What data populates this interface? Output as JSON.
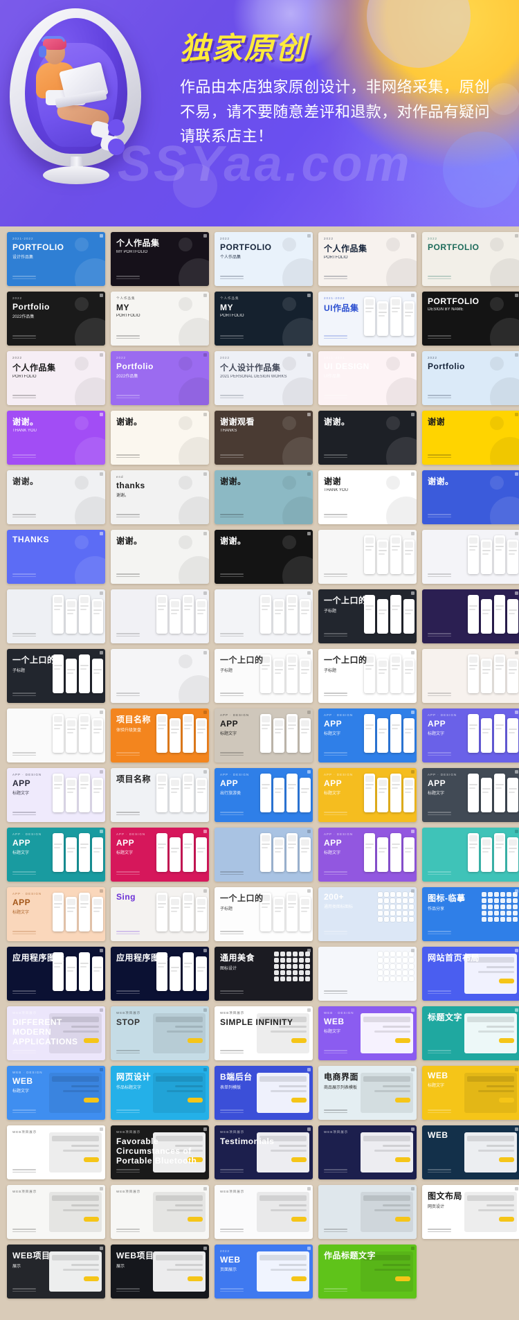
{
  "banner": {
    "title": "独家原创",
    "body": "作品由本店独家原创设计，非网络采集，原创不易，请不要随意差评和退款，对作品有疑问请联系店主！",
    "watermark": "SSYaa.com",
    "colors": {
      "bg_purple": "#6d4fe8",
      "title_yellow": "#ffeb3b",
      "sun_yellow": "#ffc93a",
      "page_bg": "#d9cbb8"
    },
    "illustration": "person-on-egg-chair-with-laptop"
  },
  "grid": {
    "columns": 5,
    "thumbs": [
      {
        "id": 1,
        "title": "PORTFOLIO",
        "sub": "设计作品集",
        "kicker": "2021-2022",
        "bg": "#2f7fd4",
        "fg": "#ffffff",
        "style": "blue-chart"
      },
      {
        "id": 2,
        "title": "个人作品集",
        "sub": "MY PORTFOLIO",
        "kicker": "",
        "bg": "#16111a",
        "fg": "#ffffff",
        "style": "dark-bokeh"
      },
      {
        "id": 3,
        "title": "PORTFOLIO",
        "sub": "个人作品集",
        "kicker": "2022",
        "bg": "#e9f2fb",
        "fg": "#16243a",
        "style": "light-rocket"
      },
      {
        "id": 4,
        "title": "个人作品集",
        "sub": "PORTFOLIO",
        "kicker": "2022",
        "bg": "#f7f2ee",
        "fg": "#16243a",
        "style": "pink-rocket"
      },
      {
        "id": 5,
        "title": "PORTFOLIO",
        "sub": "",
        "kicker": "2022",
        "bg": "#f2efe8",
        "fg": "#1d6b5a",
        "style": "panda"
      },
      {
        "id": 6,
        "title": "Portfolio",
        "sub": "2022作品集",
        "kicker": "2022",
        "bg": "#1a1a1a",
        "fg": "#ffffff",
        "style": "moon"
      },
      {
        "id": 7,
        "title": "MY",
        "sub": "PORTFOLIO",
        "kicker": "个人作品集",
        "bg": "#f6f5f2",
        "fg": "#1a1a1a",
        "style": "guitar"
      },
      {
        "id": 8,
        "title": "MY",
        "sub": "PORTFOLIO",
        "kicker": "个人作品集",
        "bg": "#15212e",
        "fg": "#ffffff",
        "style": "dark-mountain"
      },
      {
        "id": 9,
        "title": "UI作品集",
        "sub": "",
        "kicker": "2021-2022",
        "bg": "#f2f5fb",
        "fg": "#2b4fd0",
        "style": "ui-person"
      },
      {
        "id": 10,
        "title": "PORTFOLIO",
        "sub": "DESIGN BY NAME",
        "kicker": "",
        "bg": "#141414",
        "fg": "#ffffff",
        "style": "black-portfolio"
      },
      {
        "id": 11,
        "title": "个人作品集",
        "sub": "PORTFOLIO",
        "kicker": "2022",
        "bg": "#f6eef5",
        "fg": "#1a1a1a",
        "style": "pastel-pen"
      },
      {
        "id": 12,
        "title": "Portfolio",
        "sub": "2022作品集",
        "kicker": "2022",
        "bg": "#9b6bf0",
        "fg": "#ffffff",
        "style": "purple-portfolio"
      },
      {
        "id": 13,
        "title": "个人设计作品集",
        "sub": "2021 PERSONAL DESIGN WORKS",
        "kicker": "2022",
        "bg": "#eef0f6",
        "fg": "#444a5a",
        "style": "blobs"
      },
      {
        "id": 14,
        "title": "UI DESIGN",
        "sub": "UI作品集",
        "kicker": "2021-2022",
        "bg": "#fdf3f5",
        "fg": "#ffffff",
        "style": "pink-ui"
      },
      {
        "id": 15,
        "title": "Portfolio",
        "sub": "",
        "kicker": "2022",
        "bg": "#dbeaf8",
        "fg": "#16243a",
        "style": "soft-blue"
      },
      {
        "id": 16,
        "title": "谢谢。",
        "sub": "THANK YOU",
        "kicker": "",
        "bg": "#a24df5",
        "fg": "#ffffff",
        "style": "purple-thanks"
      },
      {
        "id": 17,
        "title": "谢谢。",
        "sub": "",
        "kicker": "",
        "bg": "#fbf7ef",
        "fg": "#1a1a1a",
        "style": "bauhaus"
      },
      {
        "id": 18,
        "title": "谢谢观看",
        "sub": "THANKS",
        "kicker": "",
        "bg": "#4a3b33",
        "fg": "#ffffff",
        "style": "brown-thanks"
      },
      {
        "id": 19,
        "title": "谢谢。",
        "sub": "",
        "kicker": "",
        "bg": "#1d2026",
        "fg": "#ffffff",
        "style": "photo-dark"
      },
      {
        "id": 20,
        "title": "谢谢",
        "sub": "",
        "kicker": "",
        "bg": "#ffd400",
        "fg": "#1a1a1a",
        "style": "yellow-thanks"
      },
      {
        "id": 21,
        "title": "谢谢。",
        "sub": "",
        "kicker": "",
        "bg": "#f0f1f3",
        "fg": "#333333",
        "style": "light-thanks"
      },
      {
        "id": 22,
        "title": "thanks",
        "sub": "谢谢。",
        "kicker": "end",
        "bg": "#f2f2f2",
        "fg": "#1a1a1a",
        "style": "pencil"
      },
      {
        "id": 23,
        "title": "谢谢。",
        "sub": "",
        "kicker": "",
        "bg": "#8cb9c4",
        "fg": "#1a1a1a",
        "style": "hand-rose"
      },
      {
        "id": 24,
        "title": "谢谢",
        "sub": "THANK YOU",
        "kicker": "",
        "bg": "#ffffff",
        "fg": "#1a1a1a",
        "style": "white-thanks"
      },
      {
        "id": 25,
        "title": "谢谢。",
        "sub": "",
        "kicker": "",
        "bg": "#3b5bdb",
        "fg": "#ffffff",
        "style": "blue-thumbsup"
      },
      {
        "id": 26,
        "title": "THANKS",
        "sub": "",
        "kicker": "",
        "bg": "#5c6cf5",
        "fg": "#ffffff",
        "style": "blue-thanks-big"
      },
      {
        "id": 27,
        "title": "谢谢。",
        "sub": "",
        "kicker": "",
        "bg": "#f4f4f2",
        "fg": "#1a1a1a",
        "style": "plant"
      },
      {
        "id": 28,
        "title": "谢谢。",
        "sub": "",
        "kicker": "",
        "bg": "#141414",
        "fg": "#ffffff",
        "style": "moon-dark"
      },
      {
        "id": 29,
        "title": "",
        "sub": "",
        "kicker": "",
        "bg": "#f7f7f7",
        "fg": "#555555",
        "style": "phone-mock"
      },
      {
        "id": 30,
        "title": "",
        "sub": "",
        "kicker": "",
        "bg": "#f4f4f8",
        "fg": "#555555",
        "style": "phone-mock2"
      },
      {
        "id": 31,
        "title": "",
        "sub": "",
        "kicker": "",
        "bg": "#eef0f4",
        "fg": "#555555",
        "style": "ui-screens"
      },
      {
        "id": 32,
        "title": "",
        "sub": "",
        "kicker": "",
        "bg": "#f1f1f5",
        "fg": "#555555",
        "style": "ui-screens2"
      },
      {
        "id": 33,
        "title": "",
        "sub": "",
        "kicker": "",
        "bg": "#f3f4f7",
        "fg": "#555555",
        "style": "ui-screens3"
      },
      {
        "id": 34,
        "title": "一个上口的",
        "sub": "子标题",
        "kicker": "",
        "bg": "#22262e",
        "fg": "#ffffff",
        "style": "dark-app"
      },
      {
        "id": 35,
        "title": "",
        "sub": "",
        "kicker": "",
        "bg": "#2b1f52",
        "fg": "#ffffff",
        "style": "purple-app"
      },
      {
        "id": 36,
        "title": "一个上口的",
        "sub": "子标题",
        "kicker": "",
        "bg": "#22262e",
        "fg": "#ffffff",
        "style": "dark-app2"
      },
      {
        "id": 37,
        "title": "",
        "sub": "",
        "kicker": "",
        "bg": "#f5f5f7",
        "fg": "#555555",
        "style": "wire-grid"
      },
      {
        "id": 38,
        "title": "一个上口的",
        "sub": "子标题",
        "kicker": "",
        "bg": "#fbfbfb",
        "fg": "#333333",
        "style": "white-app"
      },
      {
        "id": 39,
        "title": "一个上口的",
        "sub": "子标题",
        "kicker": "",
        "bg": "#ffffff",
        "fg": "#222222",
        "style": "white-app2"
      },
      {
        "id": 40,
        "title": "",
        "sub": "",
        "kicker": "",
        "bg": "#f7f2ee",
        "fg": "#555555",
        "style": "beige-app"
      },
      {
        "id": 41,
        "title": "",
        "sub": "",
        "kicker": "",
        "bg": "#fafafa",
        "fg": "#555555",
        "style": "light-app"
      },
      {
        "id": 42,
        "title": "项目名称",
        "sub": "体验升级复盘",
        "kicker": "",
        "bg": "#f3851e",
        "fg": "#ffffff",
        "style": "orange-app"
      },
      {
        "id": 43,
        "title": "APP",
        "sub": "标题文字",
        "kicker": "APP · DESIGN",
        "bg": "#cfc7bb",
        "fg": "#1a1a1a",
        "style": "khaki-app"
      },
      {
        "id": 44,
        "title": "APP",
        "sub": "标题文字",
        "kicker": "APP · DESIGN",
        "bg": "#2f7fe8",
        "fg": "#ffffff",
        "style": "blue-app"
      },
      {
        "id": 45,
        "title": "APP",
        "sub": "标题文字",
        "kicker": "APP · DESIGN",
        "bg": "#6a61e8",
        "fg": "#ffffff",
        "style": "indigo-app"
      },
      {
        "id": 46,
        "title": "APP",
        "sub": "标题文字",
        "kicker": "APP · DESIGN",
        "bg": "#efeafc",
        "fg": "#2a2a3a",
        "style": "lavender-app"
      },
      {
        "id": 47,
        "title": "项目名称",
        "sub": "",
        "kicker": "",
        "bg": "#f0f2f5",
        "fg": "#222222",
        "style": "hand-phone"
      },
      {
        "id": 48,
        "title": "APP",
        "sub": "出行旅游类",
        "kicker": "APP · DESIGN",
        "bg": "#2f7fe8",
        "fg": "#ffffff",
        "style": "travel-app"
      },
      {
        "id": 49,
        "title": "APP",
        "sub": "标题文字",
        "kicker": "APP · DESIGN",
        "bg": "#f5bd1f",
        "fg": "#ffffff",
        "style": "yellow-app"
      },
      {
        "id": 50,
        "title": "APP",
        "sub": "标题文字",
        "kicker": "APP · DESIGN",
        "bg": "#414a55",
        "fg": "#ffffff",
        "style": "slate-app"
      },
      {
        "id": 51,
        "title": "APP",
        "sub": "标题文字",
        "kicker": "APP · DESIGN",
        "bg": "#199ba0",
        "fg": "#ffffff",
        "style": "teal-app"
      },
      {
        "id": 52,
        "title": "APP",
        "sub": "标题文字",
        "kicker": "APP · DESIGN",
        "bg": "#d6175b",
        "fg": "#ffffff",
        "style": "crimson-app"
      },
      {
        "id": 53,
        "title": "",
        "sub": "",
        "kicker": "",
        "bg": "#a9c3e3",
        "fg": "#333333",
        "style": "screens-blue"
      },
      {
        "id": 54,
        "title": "APP",
        "sub": "标题文字",
        "kicker": "APP · DESIGN",
        "bg": "#9257e0",
        "fg": "#ffffff",
        "style": "violet-app"
      },
      {
        "id": 55,
        "title": "",
        "sub": "",
        "kicker": "",
        "bg": "#3fc3b8",
        "fg": "#ffffff",
        "style": "mint-app"
      },
      {
        "id": 56,
        "title": "APP",
        "sub": "标题文字",
        "kicker": "APP · DESIGN",
        "bg": "#fad7bb",
        "fg": "#a3571a",
        "style": "peach-app"
      },
      {
        "id": 57,
        "title": "Sing",
        "sub": "",
        "kicker": "",
        "bg": "#f4f2f0",
        "fg": "#6a2fd6",
        "style": "sing-app"
      },
      {
        "id": 58,
        "title": "一个上口的",
        "sub": "子标题",
        "kicker": "",
        "bg": "#fdfdfd",
        "fg": "#333333",
        "style": "white-app3"
      },
      {
        "id": 59,
        "title": "200+",
        "sub": "通用类图标图标",
        "kicker": "",
        "bg": "#dce7f6",
        "fg": "#ffffff",
        "style": "icon-set"
      },
      {
        "id": 60,
        "title": "图标-临摹",
        "sub": "作品分享",
        "kicker": "",
        "bg": "#2f7fe8",
        "fg": "#ffffff",
        "style": "icon-share"
      },
      {
        "id": 61,
        "title": "应用程序图标",
        "sub": "",
        "kicker": "",
        "bg": "#0b1133",
        "fg": "#ffffff",
        "style": "app-icons"
      },
      {
        "id": 62,
        "title": "应用程序图标",
        "sub": "",
        "kicker": "",
        "bg": "#0b1133",
        "fg": "#ffffff",
        "style": "app-icons2"
      },
      {
        "id": 63,
        "title": "通用美食",
        "sub": "图标设计",
        "kicker": "",
        "bg": "#1b1b22",
        "fg": "#ffffff",
        "style": "food-icons"
      },
      {
        "id": 64,
        "title": "",
        "sub": "",
        "kicker": "",
        "bg": "#f5f7fb",
        "fg": "#333333",
        "style": "outline-icons"
      },
      {
        "id": 65,
        "title": "网站首页布局",
        "sub": "",
        "kicker": "",
        "bg": "#4a5ef0",
        "fg": "#ffffff",
        "style": "web-layout"
      },
      {
        "id": 66,
        "title": "DIFFERENT MODERN APPLICATIONS",
        "sub": "",
        "kicker": "WEB项目展示",
        "bg": "#ece6fb",
        "fg": "#ffffff",
        "style": "web-purple"
      },
      {
        "id": 67,
        "title": "STOP",
        "sub": "",
        "kicker": "WEB项目展示",
        "bg": "#c5dce6",
        "fg": "#333333",
        "style": "web-stop"
      },
      {
        "id": 68,
        "title": "SIMPLE INFINITY",
        "sub": "",
        "kicker": "WEB项目展示",
        "bg": "#ffffff",
        "fg": "#222222",
        "style": "web-simple"
      },
      {
        "id": 69,
        "title": "WEB",
        "sub": "标题文字",
        "kicker": "WEB · DESIGN",
        "bg": "#8b5cf0",
        "fg": "#ffffff",
        "style": "web-yellow-card"
      },
      {
        "id": 70,
        "title": "标题文字",
        "sub": "",
        "kicker": "",
        "bg": "#1fa8a0",
        "fg": "#ffffff",
        "style": "web-teal"
      },
      {
        "id": 71,
        "title": "WEB",
        "sub": "标题文字",
        "kicker": "WEB · DESIGN",
        "bg": "#3f8ef0",
        "fg": "#ffffff",
        "style": "web-blue"
      },
      {
        "id": 72,
        "title": "网页设计",
        "sub": "作品标题文字",
        "kicker": "",
        "bg": "#24b0e8",
        "fg": "#ffffff",
        "style": "web-cyan"
      },
      {
        "id": 73,
        "title": "B端后台",
        "sub": "表单列模版",
        "kicker": "",
        "bg": "#3b4fd8",
        "fg": "#ffffff",
        "style": "web-bend"
      },
      {
        "id": 74,
        "title": "电商界面",
        "sub": "商品展示列表模板",
        "kicker": "",
        "bg": "#e4eef2",
        "fg": "#1a1a1a",
        "style": "web-ecom"
      },
      {
        "id": 75,
        "title": "WEB",
        "sub": "标题文字",
        "kicker": "",
        "bg": "#f5c518",
        "fg": "#ffffff",
        "style": "web-gold"
      },
      {
        "id": 76,
        "title": "",
        "sub": "",
        "kicker": "WEB项目展示",
        "bg": "#ffffff",
        "fg": "#333333",
        "style": "web-arrow"
      },
      {
        "id": 77,
        "title": "Favorable Circumstances of Portable Bluetooth",
        "sub": "",
        "kicker": "WEB项目展示",
        "bg": "#1a1a1a",
        "fg": "#ffffff",
        "style": "web-orange"
      },
      {
        "id": 78,
        "title": "Testimonials",
        "sub": "",
        "kicker": "WEB项目展示",
        "bg": "#1c1f4d",
        "fg": "#ffffff",
        "style": "web-testimonial"
      },
      {
        "id": 79,
        "title": "",
        "sub": "",
        "kicker": "WEB项目展示",
        "bg": "#1c1f4d",
        "fg": "#ffffff",
        "style": "web-laptop"
      },
      {
        "id": 80,
        "title": "WEB",
        "sub": "",
        "kicker": "",
        "bg": "#13304a",
        "fg": "#ffffff",
        "style": "web-dark-edge"
      },
      {
        "id": 81,
        "title": "",
        "sub": "",
        "kicker": "WEB项目展示",
        "bg": "#f7f7f5",
        "fg": "#333333",
        "style": "web-light1"
      },
      {
        "id": 82,
        "title": "",
        "sub": "",
        "kicker": "WEB项目展示",
        "bg": "#f7f7f5",
        "fg": "#333333",
        "style": "web-man"
      },
      {
        "id": 83,
        "title": "",
        "sub": "",
        "kicker": "WEB项目展示",
        "bg": "#fbfbfc",
        "fg": "#333333",
        "style": "web-light2"
      },
      {
        "id": 84,
        "title": "",
        "sub": "",
        "kicker": "",
        "bg": "#dfe7ec",
        "fg": "#333333",
        "style": "web-eyedrop"
      },
      {
        "id": 85,
        "title": "图文布局",
        "sub": "网页设计",
        "kicker": "",
        "bg": "#ffffff",
        "fg": "#1a1a1a",
        "style": "web-layout2"
      },
      {
        "id": 86,
        "title": "WEB项目",
        "sub": "展示",
        "kicker": "",
        "bg": "#24262b",
        "fg": "#ffffff",
        "style": "web-dark1"
      },
      {
        "id": 87,
        "title": "WEB项目",
        "sub": "展示",
        "kicker": "",
        "bg": "#15171c",
        "fg": "#ffffff",
        "style": "web-dark2"
      },
      {
        "id": 88,
        "title": "WEB",
        "sub": "页面展示",
        "kicker": "2022",
        "bg": "#3f79f0",
        "fg": "#ffffff",
        "style": "web-blue-grid"
      },
      {
        "id": 89,
        "title": "作品标题文字",
        "sub": "",
        "kicker": "",
        "bg": "#5fc31a",
        "fg": "#ffffff",
        "style": "web-green"
      }
    ]
  }
}
